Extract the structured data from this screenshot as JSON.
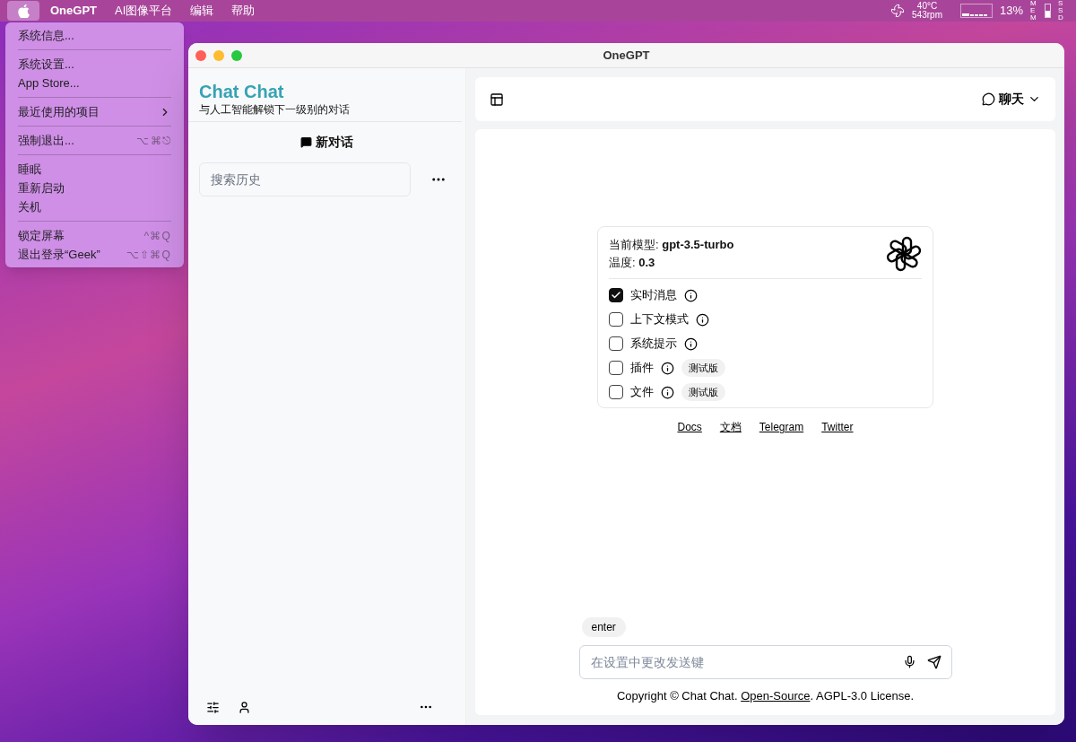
{
  "menu_bar": {
    "apple_selected": true,
    "menus": [
      {
        "label": "OneGPT",
        "bold": true
      },
      {
        "label": "AI图像平台",
        "bold": false
      },
      {
        "label": "编辑",
        "bold": false
      },
      {
        "label": "帮助",
        "bold": false
      }
    ],
    "status": {
      "temperature": "40°C",
      "fan": "543rpm",
      "cpu": "13%",
      "mem": "MEM",
      "ssd": "SSD"
    }
  },
  "apple_menu": {
    "groups": [
      [
        {
          "label": "系统信息..."
        }
      ],
      [
        {
          "label": "系统设置..."
        },
        {
          "label": "App Store..."
        }
      ],
      [
        {
          "label": "最近使用的项目",
          "submenu": true
        }
      ],
      [
        {
          "label": "强制退出...",
          "shortcut": "⌥⌘⎋"
        }
      ],
      [
        {
          "label": "睡眠"
        },
        {
          "label": "重新启动"
        },
        {
          "label": "关机"
        }
      ],
      [
        {
          "label": "锁定屏幕",
          "shortcut": "^⌘Q"
        },
        {
          "label": "退出登录“Geek”",
          "shortcut": "⌥⇧⌘Q"
        }
      ]
    ]
  },
  "window": {
    "title": "OneGPT"
  },
  "sidebar": {
    "brand": "Chat Chat",
    "tagline": "与人工智能解锁下一级别的对话",
    "new_chat": "新对话",
    "search": {
      "placeholder": "搜索历史"
    }
  },
  "header": {
    "mode": "聊天"
  },
  "info_card": {
    "model": "当前模型: **gpt-3.5-turbo**",
    "temperature": "温度: **0.3**",
    "options": [
      {
        "label": "实时消息",
        "checked": true
      },
      {
        "label": "上下文模式",
        "checked": false
      },
      {
        "label": "系统提示",
        "checked": false
      },
      {
        "label": "插件",
        "checked": false,
        "badge": "测试版"
      },
      {
        "label": "文件",
        "checked": false,
        "badge": "测试版"
      }
    ]
  },
  "links": [
    "Docs",
    "文档",
    "Telegram",
    "Twitter"
  ],
  "send_key_hint": "enter",
  "input": {
    "placeholder": "在设置中更改发送键"
  },
  "footer": {
    "before": "Copyright © Chat Chat. ",
    "link": "Open-Source",
    "after": ". AGPL-3.0 License."
  }
}
